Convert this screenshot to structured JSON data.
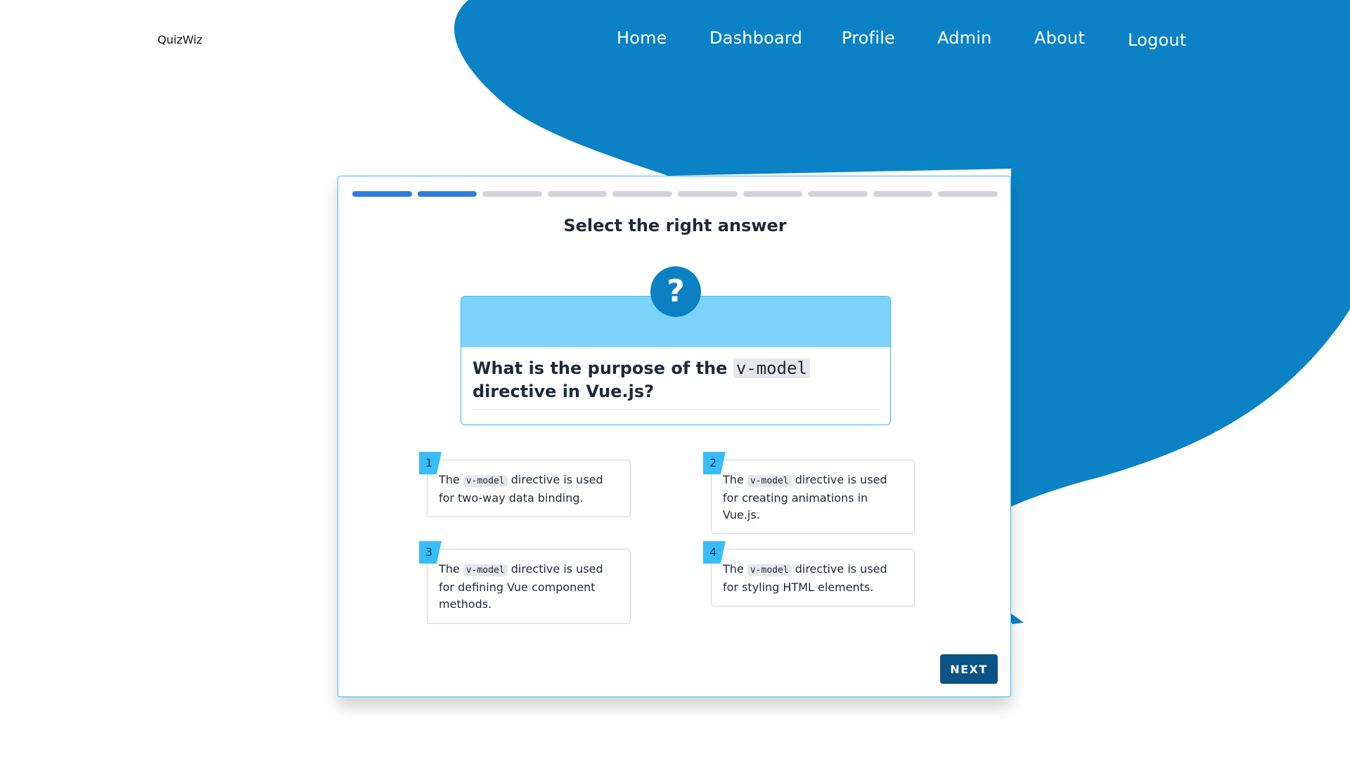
{
  "header": {
    "logo": "QuizWiz",
    "nav": [
      {
        "label": "Home"
      },
      {
        "label": "Dashboard"
      },
      {
        "label": "Profile"
      },
      {
        "label": "Admin"
      },
      {
        "label": "About"
      },
      {
        "label": "Logout"
      }
    ]
  },
  "quiz": {
    "progress": {
      "current": 2,
      "total": 10
    },
    "title": "Select the right answer",
    "question_icon": "question-mark-icon",
    "question": {
      "before": "What is the purpose of the ",
      "code": "v-model",
      "after": " directive in Vue.js?"
    },
    "options": [
      {
        "number": "1",
        "before": "The ",
        "code": "v-model",
        "after": " directive is used for two-way data binding."
      },
      {
        "number": "2",
        "before": "The ",
        "code": "v-model",
        "after": " directive is used for creating animations in Vue.js."
      },
      {
        "number": "3",
        "before": "The ",
        "code": "v-model",
        "after": " directive is used for defining Vue component methods."
      },
      {
        "number": "4",
        "before": "The ",
        "code": "v-model",
        "after": " directive is used for styling HTML elements."
      }
    ],
    "next_label": "NEXT"
  },
  "colors": {
    "brand_blue": "#0b82c6",
    "progress_done": "#2e7be0",
    "progress_todo": "#d1d5db",
    "question_header": "#7dd3fc",
    "accent": "#38bdf8",
    "next_button": "#0a5384"
  }
}
